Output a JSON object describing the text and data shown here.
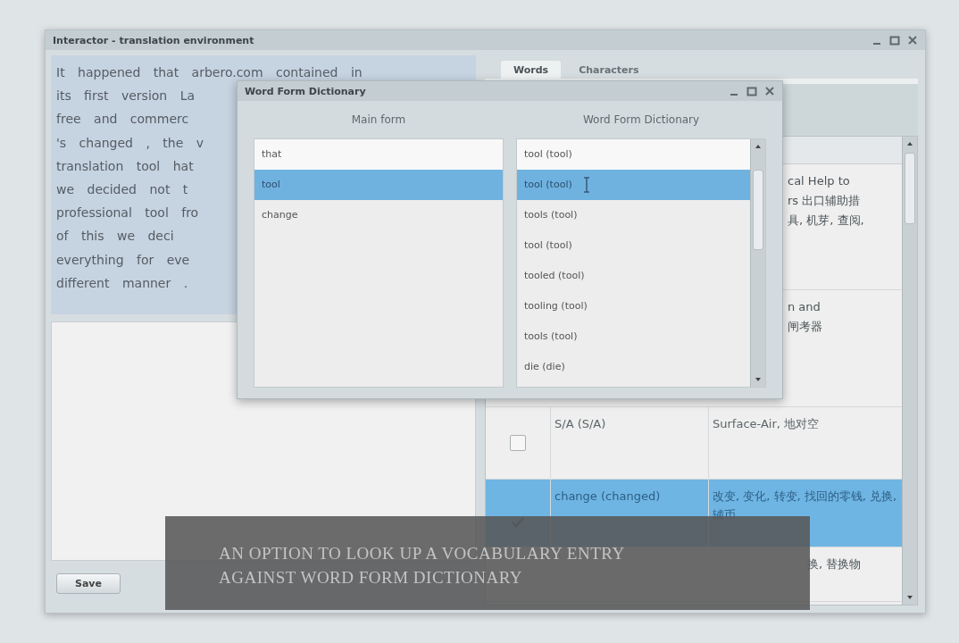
{
  "main_window": {
    "title": "Interactor - translation environment",
    "source_text_lines": [
      "It happened that arbero.com contained in",
      "its first version La",
      "free and commerc",
      "'s changed , the v",
      "translation tool hat",
      "we decided not t",
      "professional tool fro",
      "of this we deci",
      "everything for eve",
      "different manner ."
    ],
    "save_button": "Save",
    "tabs": [
      {
        "label": "Words",
        "selected": true
      },
      {
        "label": "Characters",
        "selected": false
      }
    ],
    "table_rows": [
      {
        "kind": "partial",
        "selected": false,
        "lines": [
          "cal Help to",
          "rs 出口辅助措",
          "具, 机芽, 查阅,"
        ]
      },
      {
        "kind": "partial",
        "selected": false,
        "lines": [
          "n and",
          "闸考器"
        ]
      },
      {
        "kind": "full",
        "selected": false,
        "checked": false,
        "term": "S/A (S/A)",
        "translation": "Surface-Air, 地对空"
      },
      {
        "kind": "full",
        "selected": true,
        "checked": true,
        "term": "change (changed)",
        "translation": "改变, 变化, 转变, 找回的零钱, 兑换, 辅币"
      },
      {
        "kind": "partial",
        "selected": false,
        "lines": [
          "换, 替换物"
        ]
      }
    ]
  },
  "dialog": {
    "title": "Word Form Dictionary",
    "main_form": {
      "heading": "Main form",
      "items": [
        {
          "label": "that",
          "selected": false
        },
        {
          "label": "tool",
          "selected": true
        },
        {
          "label": "change",
          "selected": false
        }
      ]
    },
    "word_forms": {
      "heading": "Word Form Dictionary",
      "items": [
        {
          "label": "tool (tool)",
          "selected": false
        },
        {
          "label": "tool (tool)",
          "selected": true
        },
        {
          "label": "tools (tool)",
          "selected": false
        },
        {
          "label": "tool (tool)",
          "selected": false
        },
        {
          "label": "tooled (tool)",
          "selected": false
        },
        {
          "label": "tooling (tool)",
          "selected": false
        },
        {
          "label": "tools (tool)",
          "selected": false
        },
        {
          "label": "die (die)",
          "selected": false
        }
      ]
    }
  },
  "caption": {
    "lines": [
      "AN OPTION TO LOOK UP A VOCABULARY ENTRY",
      "AGAINST WORD FORM DICTIONARY"
    ]
  }
}
